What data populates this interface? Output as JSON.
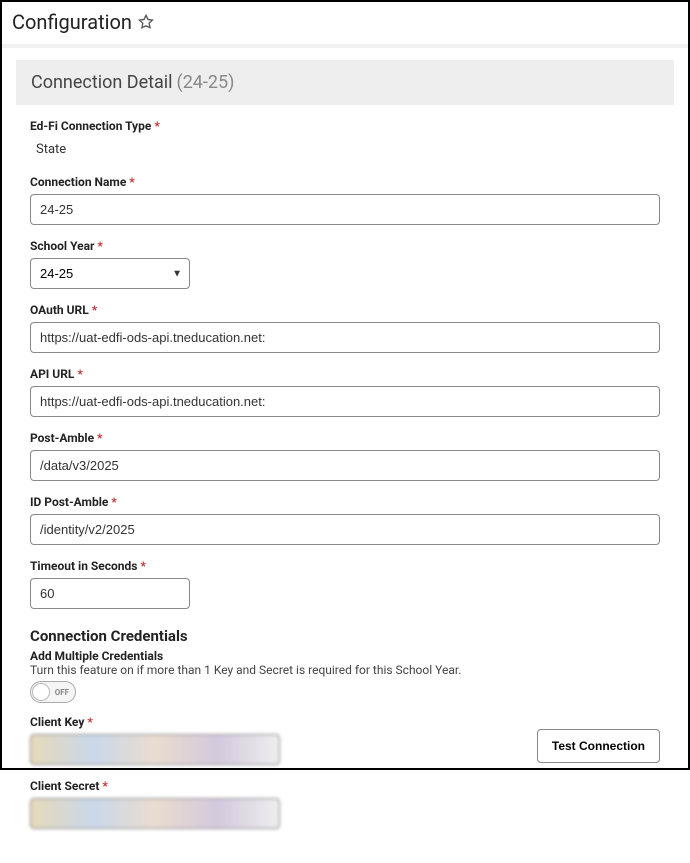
{
  "header": {
    "title": "Configuration"
  },
  "section": {
    "title": "Connection Detail",
    "year": "(24-25)"
  },
  "fields": {
    "conn_type_label": "Ed-Fi Connection Type",
    "conn_type_value": "State",
    "conn_name_label": "Connection Name",
    "conn_name_value": "24-25",
    "school_year_label": "School Year",
    "school_year_value": "24-25",
    "oauth_label": "OAuth URL",
    "oauth_value": "https://uat-edfi-ods-api.tneducation.net:",
    "api_label": "API URL",
    "api_value": "https://uat-edfi-ods-api.tneducation.net:",
    "postamble_label": "Post-Amble",
    "postamble_value": "/data/v3/2025",
    "idpostamble_label": "ID Post-Amble",
    "idpostamble_value": "/identity/v2/2025",
    "timeout_label": "Timeout in Seconds",
    "timeout_value": "60"
  },
  "credentials": {
    "heading": "Connection Credentials",
    "multi_label": "Add Multiple Credentials",
    "multi_help": "Turn this feature on if more than 1 Key and Secret is required for this School Year.",
    "toggle_state": "OFF",
    "client_key_label": "Client Key",
    "client_key_value": "••••••••",
    "client_secret_label": "Client Secret",
    "client_secret_value": "••••••••••••",
    "test_btn": "Test Connection"
  }
}
